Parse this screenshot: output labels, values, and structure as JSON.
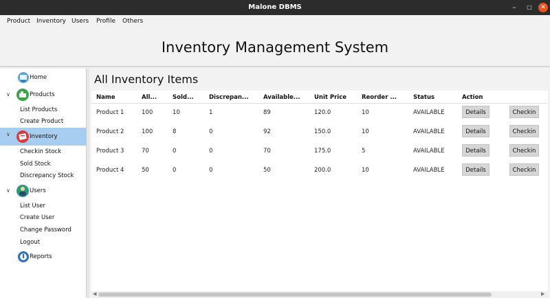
{
  "window": {
    "title": "Malone DBMS"
  },
  "menu": [
    "Product",
    "Inventory",
    "Users",
    "Profile",
    "Others"
  ],
  "header": {
    "title": "Inventory Management System"
  },
  "sidebar": {
    "home": "Home",
    "products": {
      "label": "Products",
      "items": [
        "List Products",
        "Create Product"
      ]
    },
    "inventory": {
      "label": "Inventory",
      "items": [
        "Checkin Stock",
        "Sold Stock",
        "Discrepancy Stock"
      ]
    },
    "users": {
      "label": "Users",
      "items": [
        "List User",
        "Create User",
        "Change Password",
        "Logout"
      ]
    },
    "reports": "Reports",
    "chevron": "∨"
  },
  "main": {
    "title": "All Inventory Items",
    "columns": [
      "Name",
      "All...",
      "Sold...",
      "Discrepan...",
      "Available...",
      "Unit Price",
      "Reorder ...",
      "Status",
      "Action"
    ],
    "rows": [
      {
        "name": "Product 1",
        "all": "100",
        "sold": "10",
        "disc": "1",
        "avail": "89",
        "price": "120.0",
        "reorder": "10",
        "status": "AVAILABLE"
      },
      {
        "name": "Product 2",
        "all": "100",
        "sold": "8",
        "disc": "0",
        "avail": "92",
        "price": "150.0",
        "reorder": "10",
        "status": "AVAILABLE"
      },
      {
        "name": "Product 3",
        "all": "70",
        "sold": "0",
        "disc": "0",
        "avail": "70",
        "price": "175.0",
        "reorder": "5",
        "status": "AVAILABLE"
      },
      {
        "name": "Product 4",
        "all": "50",
        "sold": "0",
        "disc": "0",
        "avail": "50",
        "price": "200.0",
        "reorder": "10",
        "status": "AVAILABLE"
      }
    ],
    "details_label": "Details",
    "checkin_label": "Checkin"
  },
  "colors": {
    "titlebar": "#2c2c2c",
    "close": "#e95420",
    "active": "#a7cdf0"
  }
}
